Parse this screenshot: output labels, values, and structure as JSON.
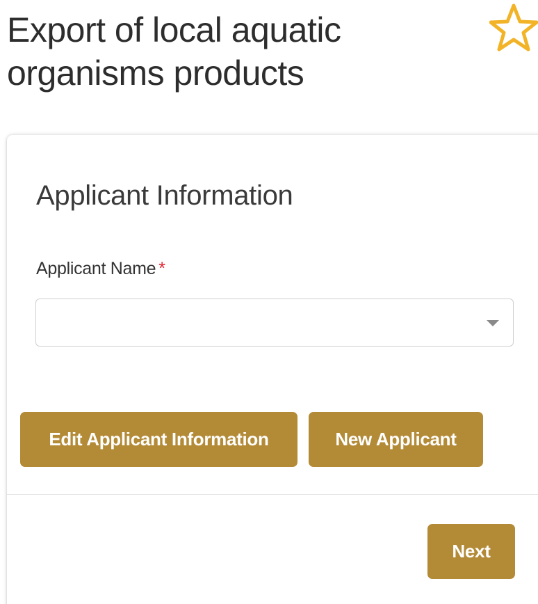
{
  "page": {
    "title_line1": "Export of local aquatic",
    "title_line2": "organisms products",
    "favorite_icon": "star-outline-icon",
    "accent_color": "#f2b327"
  },
  "form": {
    "section_title": "Applicant Information",
    "applicant_name": {
      "label": "Applicant Name",
      "required_mark": "*",
      "value": ""
    },
    "buttons": {
      "edit_label": "Edit Applicant Information",
      "new_label": "New Applicant",
      "next_label": "Next"
    },
    "button_color": "#b38a35"
  }
}
